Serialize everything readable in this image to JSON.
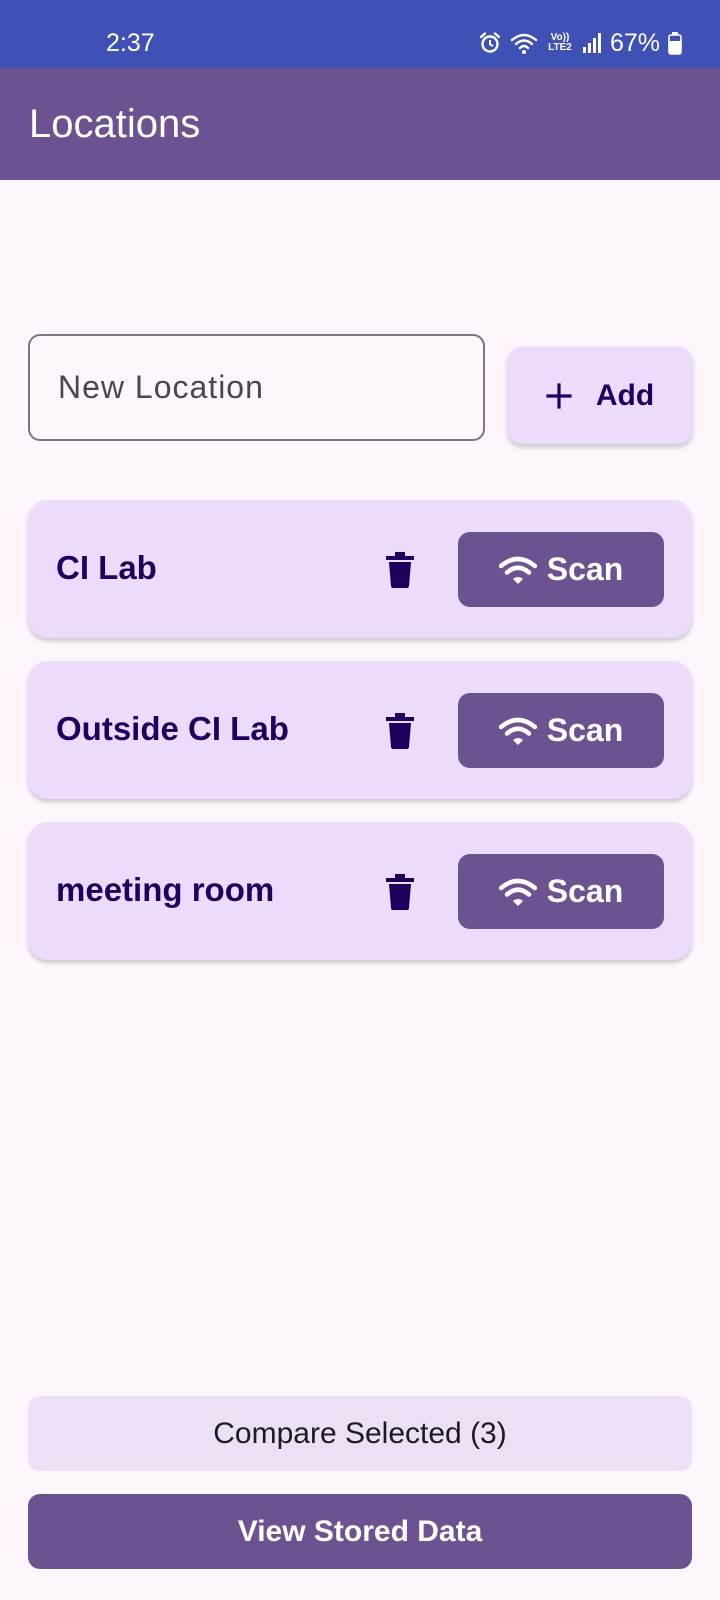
{
  "status_bar": {
    "time": "2:37",
    "volte_top": "Vo))",
    "volte_bottom": "LTE2",
    "battery": "67%",
    "icons": [
      "alarm-icon",
      "wifi-icon",
      "volte-icon",
      "signal-icon",
      "battery-icon"
    ]
  },
  "app_bar": {
    "title": "Locations"
  },
  "new_location": {
    "placeholder": "New Location",
    "value": ""
  },
  "add_button": {
    "icon": "plus-icon",
    "label": "Add"
  },
  "locations": [
    {
      "name": "CI Lab",
      "scan_label": "Scan"
    },
    {
      "name": "Outside CI Lab",
      "scan_label": "Scan"
    },
    {
      "name": "meeting room",
      "scan_label": "Scan"
    }
  ],
  "footer": {
    "compare_label": "Compare Selected (3)",
    "view_label": "View Stored Data"
  },
  "colors": {
    "status_bar": "#3f51b5",
    "app_bar": "#6d5291",
    "card_background": "#ecdcfc",
    "primary": "#6d5291",
    "on_card_text": "#21005d",
    "page_background": "#fdf7fd"
  }
}
